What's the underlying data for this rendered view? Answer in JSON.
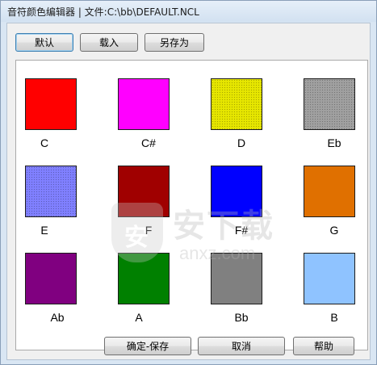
{
  "window": {
    "title": "音符颜色编辑器 | 文件:C:\\bb\\DEFAULT.NCL"
  },
  "toolbar": {
    "default_label": "默认",
    "load_label": "载入",
    "save_as_label": "另存为"
  },
  "watermark": {
    "cn": "安下载",
    "en": "anxz.com"
  },
  "colors": [
    {
      "note": "C",
      "hex": "#ff0000"
    },
    {
      "note": "C#",
      "hex": "#ff00ff"
    },
    {
      "note": "D",
      "hex": "#e6e600"
    },
    {
      "note": "Eb",
      "hex": "#a0a0a0"
    },
    {
      "note": "E",
      "hex": "#8080ff"
    },
    {
      "note": "F",
      "hex": "#a00000"
    },
    {
      "note": "F#",
      "hex": "#0000ff"
    },
    {
      "note": "G",
      "hex": "#e07000"
    },
    {
      "note": "Ab",
      "hex": "#800080"
    },
    {
      "note": "A",
      "hex": "#008000"
    },
    {
      "note": "Bb",
      "hex": "#808080"
    },
    {
      "note": "B",
      "hex": "#8fc3ff"
    }
  ],
  "footer": {
    "ok_save_label": "确定-保存",
    "cancel_label": "取消",
    "help_label": "帮助"
  }
}
